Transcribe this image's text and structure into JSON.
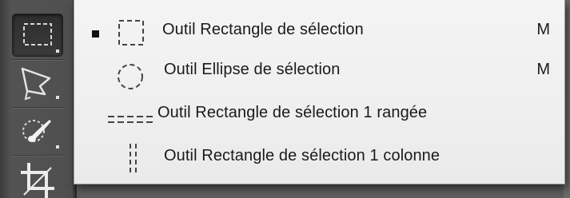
{
  "toolbar": {
    "tools": [
      {
        "icon": "rectangular-marquee-icon",
        "active": true
      },
      {
        "icon": "polygonal-lasso-icon",
        "active": false
      },
      {
        "icon": "quick-selection-icon",
        "active": false
      },
      {
        "icon": "crop-icon",
        "active": false
      }
    ]
  },
  "flyout": {
    "items": [
      {
        "label": "Outil Rectangle de sélection",
        "shortcut": "M",
        "selected": true,
        "icon": "rectangle-marquee-icon"
      },
      {
        "label": "Outil Ellipse de sélection",
        "shortcut": "M",
        "selected": false,
        "icon": "ellipse-marquee-icon"
      },
      {
        "label": "Outil Rectangle de sélection 1 rangée",
        "shortcut": "",
        "selected": false,
        "icon": "single-row-marquee-icon"
      },
      {
        "label": "Outil Rectangle de sélection 1 colonne",
        "shortcut": "",
        "selected": false,
        "icon": "single-column-marquee-icon"
      }
    ]
  },
  "colors": {
    "menu_background": "#f0f0f0",
    "toolbar_background": "#4f4f4f",
    "text": "#1a1a1a"
  }
}
